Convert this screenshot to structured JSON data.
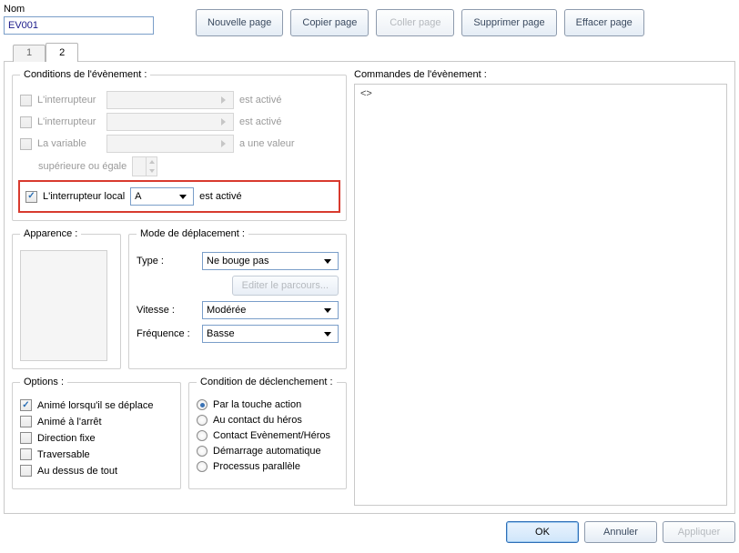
{
  "name_label": "Nom",
  "name_value": "EV001",
  "toolbar": {
    "new_page": "Nouvelle page",
    "copy_page": "Copier page",
    "paste_page": "Coller page",
    "delete_page": "Supprimer page",
    "clear_page": "Effacer page"
  },
  "tabs": {
    "t1": "1",
    "t2": "2"
  },
  "conditions": {
    "legend": "Conditions de l'évènement :",
    "switch_label": "L'interrupteur",
    "switch_suffix": "est activé",
    "variable_label": "La variable",
    "variable_suffix": "a une valeur",
    "variable_comp": "supérieure ou égale",
    "self_switch_label": "L'interrupteur local",
    "self_switch_value": "A",
    "self_switch_suffix": "est activé"
  },
  "appearance": {
    "legend": "Apparence :"
  },
  "movement": {
    "legend": "Mode de déplacement :",
    "type_label": "Type :",
    "type_value": "Ne bouge pas",
    "edit_route": "Editer le parcours...",
    "speed_label": "Vitesse :",
    "speed_value": "Modérée",
    "freq_label": "Fréquence :",
    "freq_value": "Basse"
  },
  "options": {
    "legend": "Options :",
    "anim_move": "Animé lorsqu'il se déplace",
    "anim_stop": "Animé à l'arrêt",
    "dir_fix": "Direction fixe",
    "through": "Traversable",
    "above": "Au dessus de tout"
  },
  "trigger": {
    "legend": "Condition de déclenchement :",
    "action": "Par la touche action",
    "player_touch": "Au contact du héros",
    "event_touch": "Contact Evènement/Héros",
    "autorun": "Démarrage automatique",
    "parallel": "Processus parallèle"
  },
  "commands": {
    "legend": "Commandes de l'évènement :",
    "placeholder": "<>"
  },
  "footer": {
    "ok": "OK",
    "cancel": "Annuler",
    "apply": "Appliquer"
  }
}
